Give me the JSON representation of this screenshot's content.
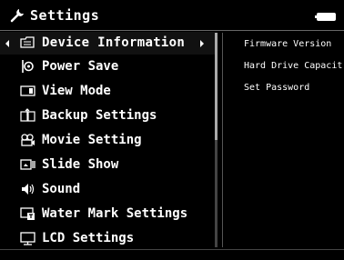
{
  "header": {
    "title": "Settings",
    "icon": "wrench-icon",
    "battery_icon": "battery-icon"
  },
  "menu": {
    "items": [
      {
        "label": "Device Information",
        "icon": "device-info-icon",
        "selected": true
      },
      {
        "label": "Power Save",
        "icon": "power-save-icon"
      },
      {
        "label": "View Mode",
        "icon": "view-mode-icon"
      },
      {
        "label": "Backup Settings",
        "icon": "backup-icon"
      },
      {
        "label": "Movie Setting",
        "icon": "movie-icon"
      },
      {
        "label": "Slide Show",
        "icon": "slideshow-icon"
      },
      {
        "label": "Sound",
        "icon": "speaker-icon"
      },
      {
        "label": "Water Mark Settings",
        "icon": "watermark-icon"
      },
      {
        "label": "LCD Settings",
        "icon": "lcd-icon"
      }
    ]
  },
  "submenu": {
    "items": [
      {
        "label": "Firmware Version"
      },
      {
        "label": "Hard Drive Capacit"
      },
      {
        "label": "Set Password"
      }
    ]
  },
  "colors": {
    "background": "#000000",
    "text": "#ffffff"
  }
}
